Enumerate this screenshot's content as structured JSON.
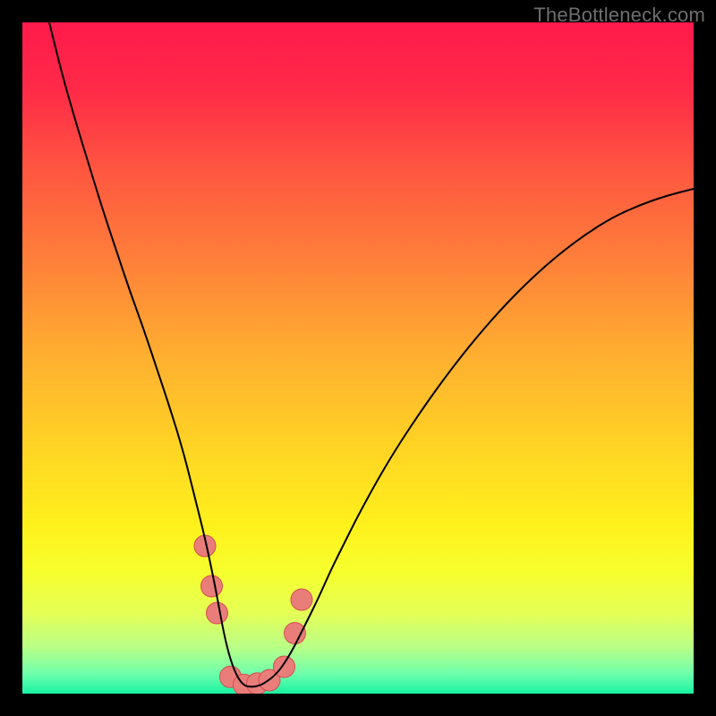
{
  "watermark": "TheBottleneck.com",
  "chart_data": {
    "type": "line",
    "title": "",
    "xlabel": "",
    "ylabel": "",
    "xlim": [
      0,
      100
    ],
    "ylim": [
      0,
      100
    ],
    "grid": false,
    "legend": false,
    "background_gradient": {
      "stops": [
        {
          "offset": 0.0,
          "color": "#ff1a4b"
        },
        {
          "offset": 0.1,
          "color": "#ff2a48"
        },
        {
          "offset": 0.22,
          "color": "#ff5640"
        },
        {
          "offset": 0.35,
          "color": "#ff7e3a"
        },
        {
          "offset": 0.5,
          "color": "#ffb030"
        },
        {
          "offset": 0.63,
          "color": "#ffd324"
        },
        {
          "offset": 0.75,
          "color": "#fff11c"
        },
        {
          "offset": 0.82,
          "color": "#f6ff2e"
        },
        {
          "offset": 0.88,
          "color": "#e5ff56"
        },
        {
          "offset": 0.93,
          "color": "#baff86"
        },
        {
          "offset": 0.97,
          "color": "#6fffab"
        },
        {
          "offset": 1.0,
          "color": "#19f3a3"
        }
      ]
    },
    "series": [
      {
        "name": "curve",
        "stroke": "#000000",
        "stroke_width": 2,
        "x": [
          4,
          5,
          6,
          8,
          10,
          12,
          14,
          16,
          18,
          20,
          22,
          24,
          26,
          27,
          28,
          29,
          30,
          31,
          32,
          33,
          34,
          35,
          36,
          38,
          40,
          42,
          44,
          46,
          48,
          50,
          53,
          56,
          60,
          64,
          68,
          72,
          76,
          80,
          84,
          88,
          92,
          96,
          100
        ],
        "y": [
          100,
          96,
          92,
          85,
          78.5,
          72,
          66,
          60,
          54.5,
          48.5,
          42.5,
          36,
          28,
          24,
          19.5,
          14.5,
          9,
          5,
          2.5,
          1.2,
          1.0,
          1.1,
          1.5,
          3,
          6,
          10,
          14,
          18.5,
          22.5,
          26.5,
          32,
          37,
          43,
          48.5,
          53.5,
          58,
          62,
          65.5,
          68.5,
          71,
          72.8,
          74.2,
          75.2
        ]
      }
    ],
    "markers": {
      "color": "#e97d7a",
      "outline": "#d34f4f",
      "radius": 12,
      "points": [
        {
          "x": 27.2,
          "y": 22
        },
        {
          "x": 28.2,
          "y": 16
        },
        {
          "x": 29.0,
          "y": 12
        },
        {
          "x": 31.0,
          "y": 2.5
        },
        {
          "x": 33.0,
          "y": 1.3
        },
        {
          "x": 35.0,
          "y": 1.5
        },
        {
          "x": 36.8,
          "y": 2.0
        },
        {
          "x": 39.0,
          "y": 4.0
        },
        {
          "x": 40.6,
          "y": 9.0
        },
        {
          "x": 41.6,
          "y": 14.0
        }
      ]
    }
  }
}
